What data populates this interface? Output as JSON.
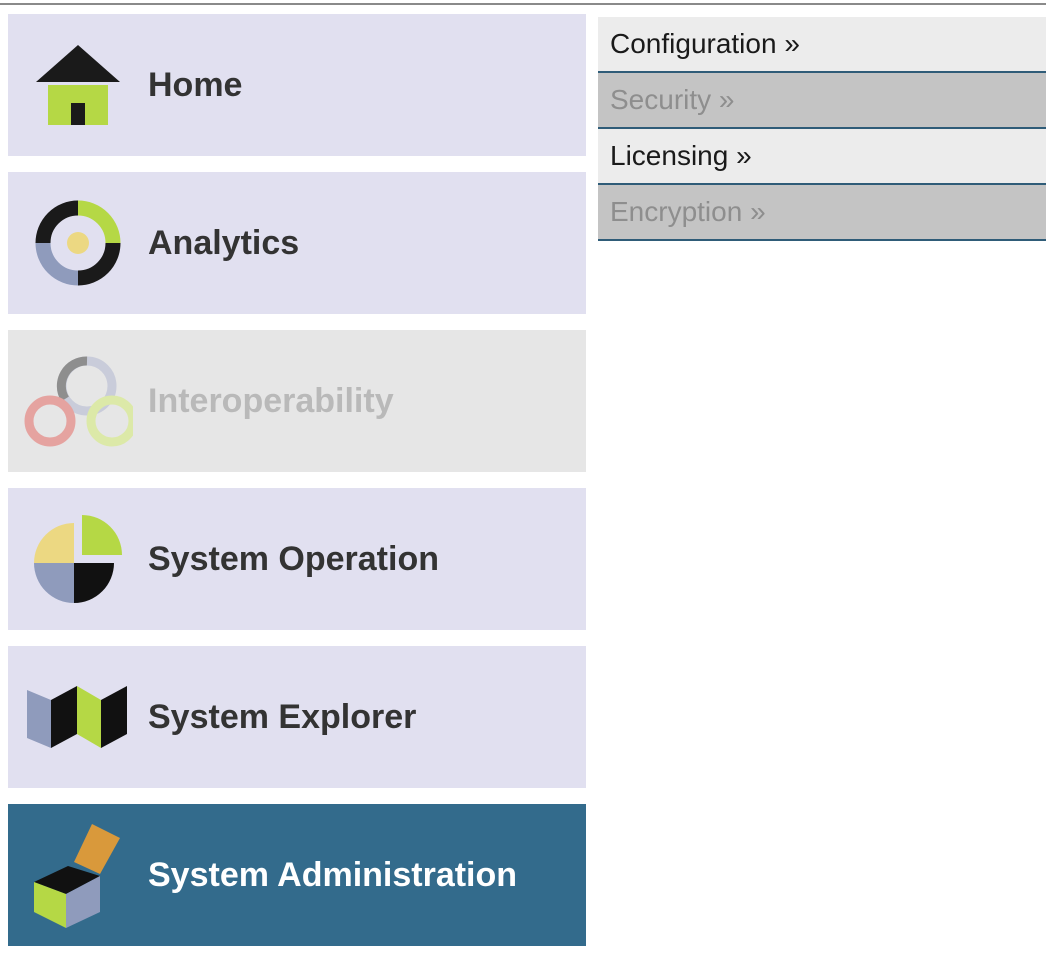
{
  "colors": {
    "nav_bg": "#e1e0f0",
    "nav_disabled_bg": "#e6e6e6",
    "nav_active_bg": "#336b8c",
    "submenu_enabled_bg": "#ececec",
    "submenu_disabled_bg": "#c4c4c4",
    "accent_green": "#b5d845",
    "accent_yellow": "#ecd882",
    "accent_slate": "#8f9bbc"
  },
  "nav": {
    "items": [
      {
        "label": "Home",
        "icon": "home-icon",
        "state": "normal"
      },
      {
        "label": "Analytics",
        "icon": "analytics-icon",
        "state": "normal"
      },
      {
        "label": "Interoperability",
        "icon": "interoperability-icon",
        "state": "disabled"
      },
      {
        "label": "System Operation",
        "icon": "system-operation-icon",
        "state": "normal"
      },
      {
        "label": "System Explorer",
        "icon": "system-explorer-icon",
        "state": "normal"
      },
      {
        "label": "System Administration",
        "icon": "system-administration-icon",
        "state": "active"
      }
    ]
  },
  "submenu": {
    "items": [
      {
        "label": "Configuration »",
        "state": "enabled"
      },
      {
        "label": "Security »",
        "state": "disabled"
      },
      {
        "label": "Licensing »",
        "state": "enabled"
      },
      {
        "label": "Encryption »",
        "state": "disabled"
      }
    ]
  }
}
